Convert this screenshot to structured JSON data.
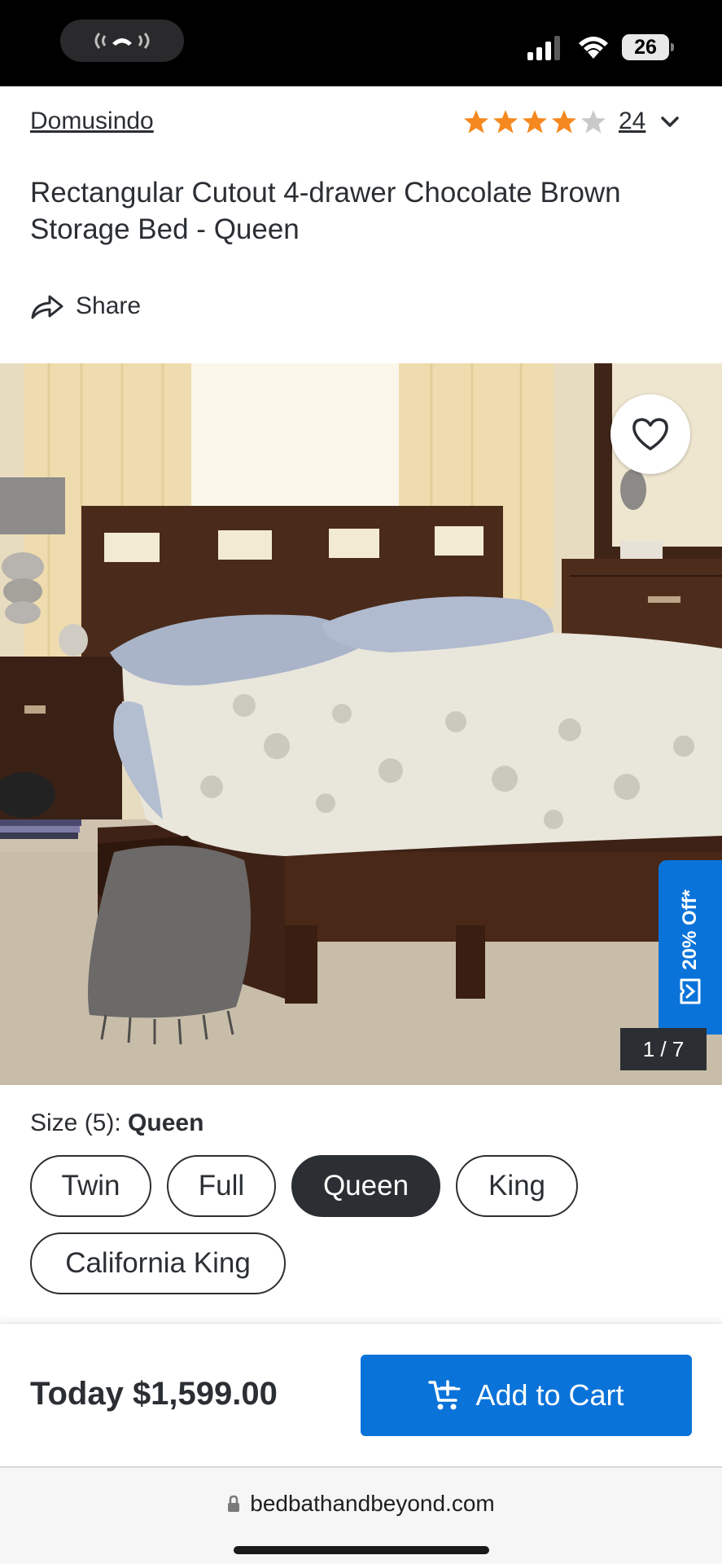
{
  "status_bar": {
    "battery_level": "26"
  },
  "product": {
    "brand": "Domusindo",
    "rating": 4.5,
    "review_count": "24",
    "title": "Rectangular Cutout 4-drawer Chocolate Brown Storage Bed - Queen",
    "share_label": "Share",
    "image_counter": "1 / 7",
    "promo_label": "20% Off*"
  },
  "size_selector": {
    "label": "Size (5):",
    "selected": "Queen",
    "options": [
      "Twin",
      "Full",
      "Queen",
      "King",
      "California King"
    ]
  },
  "purchase": {
    "price_label": "Today $1,599.00",
    "add_to_cart_label": "Add to Cart"
  },
  "browser": {
    "url": "bedbathandbeyond.com"
  },
  "colors": {
    "accent": "#0a73d9",
    "star": "#f5881f",
    "text": "#2b2f33"
  },
  "icons": [
    "call-icon",
    "signal-icon",
    "wifi-icon",
    "battery-icon",
    "star-icon",
    "chevron-down-icon",
    "share-icon",
    "heart-icon",
    "coupon-icon",
    "cart-plus-icon",
    "lock-icon"
  ]
}
